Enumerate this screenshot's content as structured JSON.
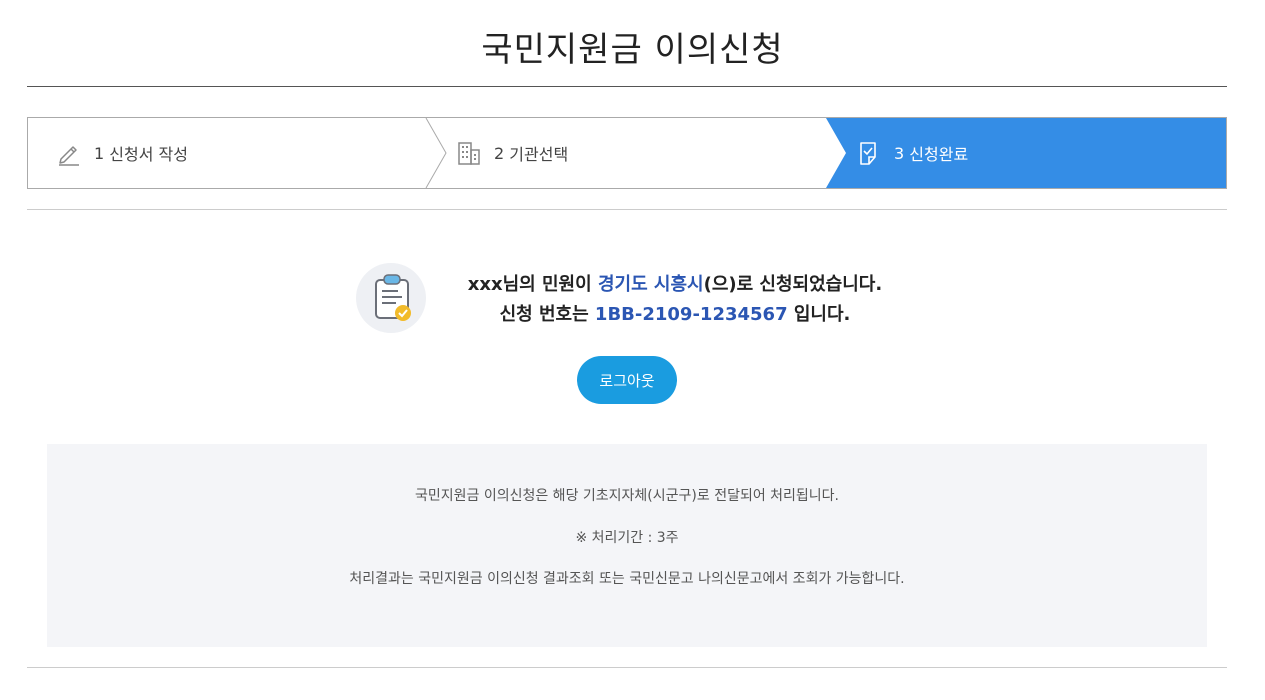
{
  "page": {
    "title": "국민지원금 이의신청"
  },
  "steps": [
    {
      "num": "1",
      "label": "신청서 작성",
      "icon": "pencil-icon",
      "active": false
    },
    {
      "num": "2",
      "label": "기관선택",
      "icon": "building-icon",
      "active": false
    },
    {
      "num": "3",
      "label": "신청완료",
      "icon": "document-check-icon",
      "active": true
    }
  ],
  "result": {
    "icon": "clipboard-check-icon",
    "line1_prefix": "xxx님의 민원이 ",
    "region": "경기도 시흥시",
    "line1_suffix": "(으)로 신청되었습니다.",
    "line2_prefix": "신청 번호는 ",
    "application_number": "1BB-2109-1234567",
    "line2_suffix": " 입니다."
  },
  "buttons": {
    "logout_label": "로그아웃"
  },
  "info": {
    "line1": "국민지원금 이의신청은 해당 기초지자체(시군구)로 전달되어 처리됩니다.",
    "line2": "※ 처리기간 : 3주",
    "line3": "처리결과는 국민지원금 이의신청 결과조회 또는 국민신문고 나의신문고에서 조회가 가능합니다."
  },
  "colors": {
    "active_step": "#348de6",
    "highlight": "#2b56b3",
    "button": "#1a9ce0",
    "info_bg": "#f4f5f8"
  }
}
